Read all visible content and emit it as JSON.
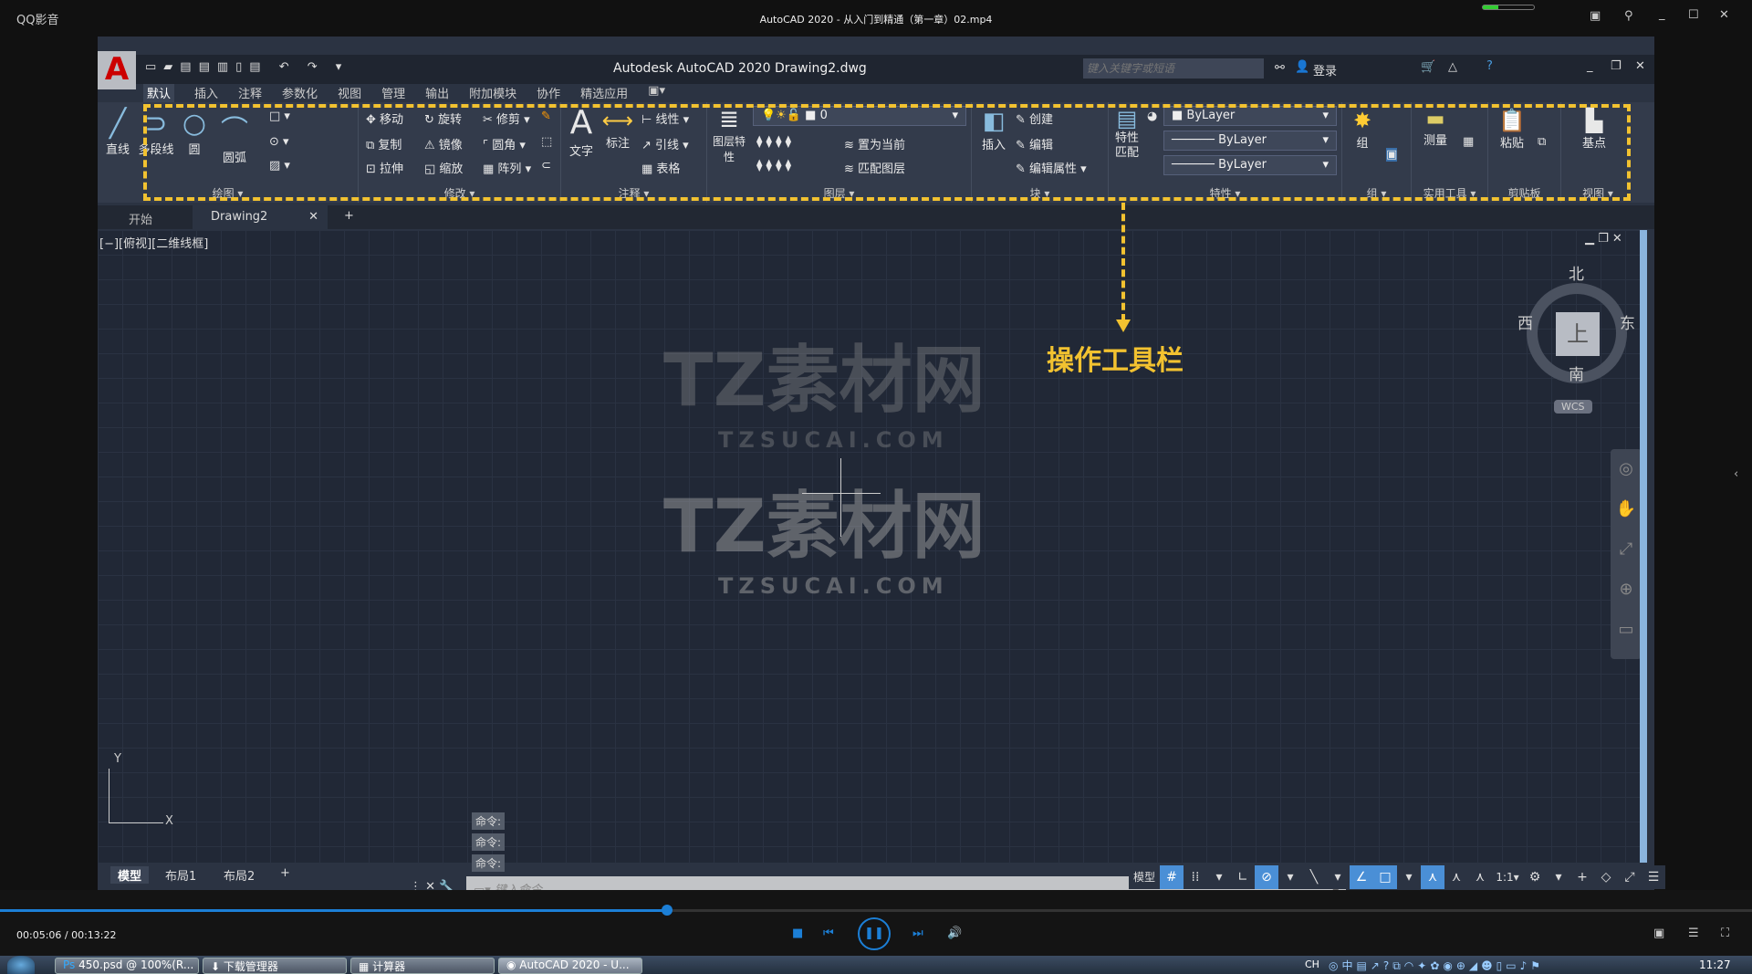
{
  "player": {
    "app_menu": "QQ影音",
    "title": "AutoCAD 2020 - 从入门到精通（第一章）02.mp4",
    "time": "00:05:06 / 00:13:22",
    "progress_percent": 38.2
  },
  "acad": {
    "title": "Autodesk AutoCAD 2020    Drawing2.dwg",
    "search_placeholder": "键入关键字或短语",
    "login": "登录",
    "ribbon_tabs": [
      "默认",
      "插入",
      "注释",
      "参数化",
      "视图",
      "管理",
      "输出",
      "附加模块",
      "协作",
      "精选应用"
    ],
    "draw_panel": {
      "label": "绘图",
      "tools": [
        "直线",
        "多段线",
        "圆",
        "圆弧"
      ]
    },
    "modify_panel": {
      "label": "修改",
      "tools": [
        "移动",
        "旋转",
        "修剪",
        "复制",
        "镜像",
        "圆角",
        "拉伸",
        "缩放",
        "阵列"
      ]
    },
    "annotation_panel": {
      "label": "注释",
      "tools": [
        "文字",
        "标注",
        "线性",
        "引线",
        "表格"
      ]
    },
    "layers_panel": {
      "label": "图层",
      "tools": [
        "图层特性",
        "置为当前",
        "匹配图层"
      ],
      "current_layer": "0"
    },
    "block_panel": {
      "label": "块",
      "tools": [
        "插入",
        "创建",
        "编辑",
        "编辑属性"
      ]
    },
    "properties_panel": {
      "label": "特性",
      "match": "特性匹配",
      "color": "ByLayer",
      "linetype": "ByLayer",
      "lineweight": "ByLayer"
    },
    "group_panel": {
      "label": "组",
      "tool": "组"
    },
    "utilities_panel": {
      "label": "实用工具",
      "tool": "测量"
    },
    "clipboard_panel": {
      "label": "剪贴板",
      "tool": "粘贴"
    },
    "view_panel": {
      "label": "视图",
      "tool": "基点"
    },
    "file_tabs": [
      "开始",
      "Drawing2"
    ],
    "viewport_label": "[−][俯视][二维线框]",
    "viewcube": {
      "north": "北",
      "south": "南",
      "east": "东",
      "west": "西",
      "top": "上",
      "wcs": "WCS"
    },
    "ucs": {
      "x": "X",
      "y": "Y"
    },
    "command_history": [
      "命令:",
      "命令:",
      "命令:"
    ],
    "command_placeholder": "键入命令",
    "layout_tabs": [
      "模型",
      "布局1",
      "布局2"
    ],
    "status_model": "模型",
    "status_scale": "1:1"
  },
  "annotation": {
    "text": "操作工具栏",
    "color": "#f2c230"
  },
  "watermark": {
    "name": "TZ素材网",
    "url": "TZSUCAI.COM"
  },
  "taskbar": {
    "items": [
      "450.psd @ 100%(R...",
      "下载管理器",
      "计算器",
      "AutoCAD 2020 - U..."
    ],
    "lang": "CH",
    "clock": "11:27"
  }
}
